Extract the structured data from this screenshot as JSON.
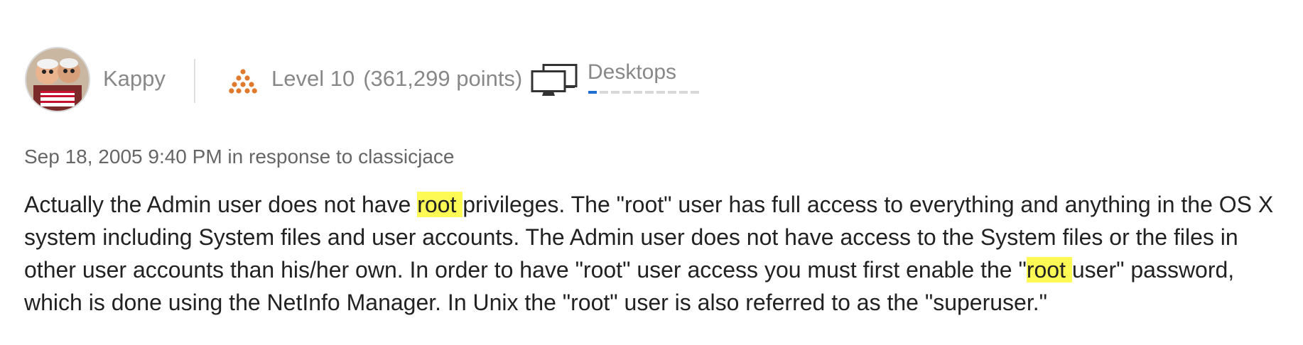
{
  "author": {
    "name": "Kappy"
  },
  "level": {
    "label": "Level 10",
    "points": "(361,299 points)"
  },
  "community": {
    "name": "Desktops"
  },
  "progress": {
    "segments": 10,
    "filled": 1
  },
  "post": {
    "meta": "Sep 18, 2005 9:40 PM in response to classicjace",
    "segments": [
      "Actually the Admin user does not have ",
      "root ",
      "privileges. The \"root\" user has full access to everything and anything in the OS X system including System files and user accounts. The Admin user does not have access to the System files or the files in other user accounts than his/her own. In order to have \"root\" user access you must first enable the \"",
      "root ",
      "user\" password, which is done using the NetInfo Manager. In Unix the \"root\" user is also referred to as the \"superuser.\""
    ]
  },
  "colors": {
    "highlight": "#fdfa56",
    "level_icon": "#e07a2e",
    "progress_fill": "#1f6fd0"
  },
  "icons": {
    "level": "level-pyramid-icon",
    "community": "desktop-monitors-icon"
  }
}
